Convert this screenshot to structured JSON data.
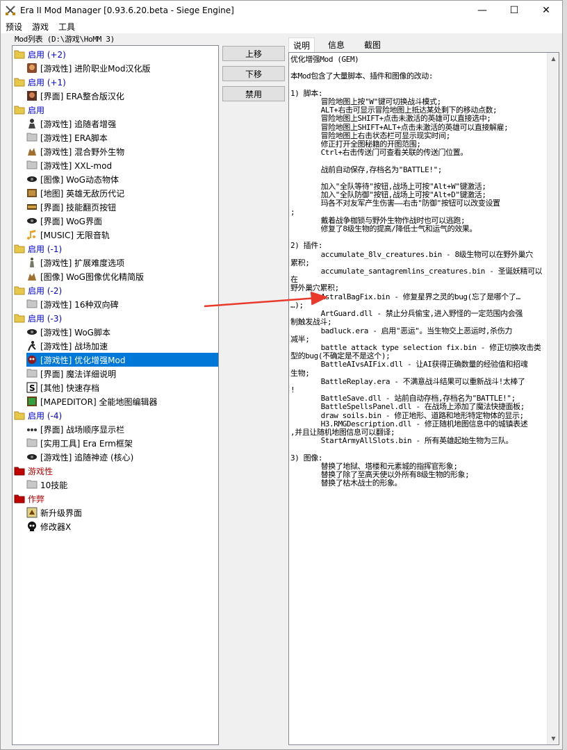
{
  "window": {
    "title": "Era II Mod Manager [0.93.6.20.beta - Siege Engine]",
    "minimize": "—",
    "maximize": "☐",
    "close": "✕"
  },
  "menu": [
    "预设",
    "游戏",
    "工具"
  ],
  "mod_list_label": "Mod列表 (D:\\游戏\\HoMM 3)",
  "tree": {
    "groups": [
      {
        "label": "启用 (+2)",
        "color": "blue",
        "items": [
          {
            "label": "[游戏性] 进阶职业Mod汉化版",
            "icon": "hero-portrait-icon"
          }
        ]
      },
      {
        "label": "启用 (+1)",
        "color": "blue",
        "items": [
          {
            "label": "[界面] ERA整合版汉化",
            "icon": "portrait-icon"
          }
        ]
      },
      {
        "label": "启用",
        "color": "blue",
        "items": [
          {
            "label": "[游戏性] 追随者增强",
            "icon": "knight-icon"
          },
          {
            "label": "[游戏性] ERA脚本",
            "icon": "folder-icon"
          },
          {
            "label": "[游戏性] 混合野外生物",
            "icon": "creature-icon"
          },
          {
            "label": "[游戏性] XXL-mod",
            "icon": "folder-icon"
          },
          {
            "label": "[图像] WoG动态物体",
            "icon": "eye-icon"
          },
          {
            "label": "[地图] 英雄无敌历代记",
            "icon": "map-icon"
          },
          {
            "label": "[界面] 技能翻页按钮",
            "icon": "panel-icon"
          },
          {
            "label": "[界面] WoG界面",
            "icon": "eye-icon"
          },
          {
            "label": "[MUSIC] 无限音轨",
            "icon": "music-note-icon"
          }
        ]
      },
      {
        "label": "启用 (-1)",
        "color": "blue",
        "items": [
          {
            "label": "[游戏性] 扩展难度选项",
            "icon": "figure-icon"
          },
          {
            "label": "[图像] WoG图像优化精简版",
            "icon": "creature-icon"
          }
        ]
      },
      {
        "label": "启用 (-2)",
        "color": "blue",
        "items": [
          {
            "label": "[游戏性] 16种双向碑",
            "icon": "folder-icon"
          }
        ]
      },
      {
        "label": "启用 (-3)",
        "color": "blue",
        "items": [
          {
            "label": "[游戏性] WoG脚本",
            "icon": "eye-icon"
          },
          {
            "label": "[游戏性] 战场加速",
            "icon": "runner-icon"
          },
          {
            "label": "[游戏性] 优化增强Mod",
            "icon": "gem-creature-icon",
            "selected": true
          },
          {
            "label": "[界面] 魔法详细说明",
            "icon": "folder-icon"
          },
          {
            "label": "[其他] 快速存档",
            "icon": "save-s-icon"
          },
          {
            "label": "[MAPEDITOR] 全能地图编辑器",
            "icon": "map-editor-icon"
          }
        ]
      },
      {
        "label": "启用 (-4)",
        "color": "blue",
        "items": [
          {
            "label": "[界面] 战场顺序显示栏",
            "icon": "order-bar-icon"
          },
          {
            "label": "[实用工具] Era Erm框架",
            "icon": "folder-icon"
          },
          {
            "label": "[游戏性] 追随神迹 (核心)",
            "icon": "eye-icon"
          }
        ]
      },
      {
        "label": "游戏性",
        "color": "red",
        "items": [
          {
            "label": "10技能",
            "icon": "folder-icon"
          }
        ]
      },
      {
        "label": "作弊",
        "color": "red",
        "items": [
          {
            "label": "新升级界面",
            "icon": "upgrade-icon"
          },
          {
            "label": "修改器X",
            "icon": "skull-icon"
          }
        ]
      }
    ]
  },
  "buttons": {
    "up": "上移",
    "down": "下移",
    "disable": "禁用"
  },
  "tabs": [
    "说明",
    "信息",
    "截图"
  ],
  "description": "优化增强Mod (GEM)\n\n本Mod包含了大量脚本、插件和图像的改动:\n\n1) 脚本:\n       冒险地图上按\"W\"键可切换战斗模式;\n       ALT+右击可显示冒险地图上抵达某处剩下的移动点数;\n       冒险地图上SHIFT+点击未激活的英雄可以直接选中;\n       冒险地图上SHIFT+ALT+点击未激活的英雄可以直接解雇;\n       冒险地图上右击状态栏可显示现实时间;\n       修正打开全图秘籍的开图范围;\n       Ctrl+右击传送门可查看关联的传送门位置。\n\n       战前自动保存,存档名为\"BATTLE!\";\n\n       加入\"全队等待\"按钮,战场上可按\"Alt+W\"键激活;\n       加入\"全队防御\"按钮,战场上可按\"Alt+D\"键激活;\n       玛各不对友军产生伤害——右击\"防御\"按钮可以改变设置\n;\n       戴着战争枷锁与野外生物作战时也可以逃跑;\n       修复了8级生物的提高/降低士气和运气的效果。\n\n2) 插件:\n       accumulate_8lv_creatures.bin - 8级生物可以在野外巢穴\n累积;\n       accumulate_santagremlins_creatures.bin - 圣诞妖精可以在\n野外巢穴累积;\n       AstralBagFix.bin - 修复星界之灵的bug(忘了是哪个了…\n…);\n       ArtGuard.dll - 禁止分兵偷宝,进入野怪的一定范围内会强\n制触发战斗;\n       badluck.era - 启用\"恶运\"。当生物交上恶运时,杀伤力\n减半;\n       battle attack type selection fix.bin - 修正切换攻击类\n型的bug(不确定是不是这个);\n       BattleAIvsAIFix.dll - 让AI获得正确数量的经验值和招魂\n生物;\n       BattleReplay.era - 不满意战斗结果可以重新战斗!太棒了\n!\n       BattleSave.dll - 站前自动存档,存档名为\"BATTLE!\";\n       BattleSpellsPanel.dll - 在战场上添加了魔法快捷面板;\n       draw soils.bin - 修正地形、道路和地形特定物体的显示;\n       H3.RMGDescription.dll - 修正随机地图信息中的城镇表述\n,并且让随机地图信息可以翻译;\n       StartArmyAllSlots.bin - 所有英雄起始生物为三队。\n\n3) 图像:\n       替换了地狱、塔楼和元素城的指挥官形象;\n       替换了除了至高天使以外所有8级生物的形象;\n       替换了枯木战士的形象。",
  "colors": {
    "group_blue": "#0000e0",
    "group_red": "#c00000",
    "selection": "#0078d7",
    "arrow": "#e8392b"
  }
}
